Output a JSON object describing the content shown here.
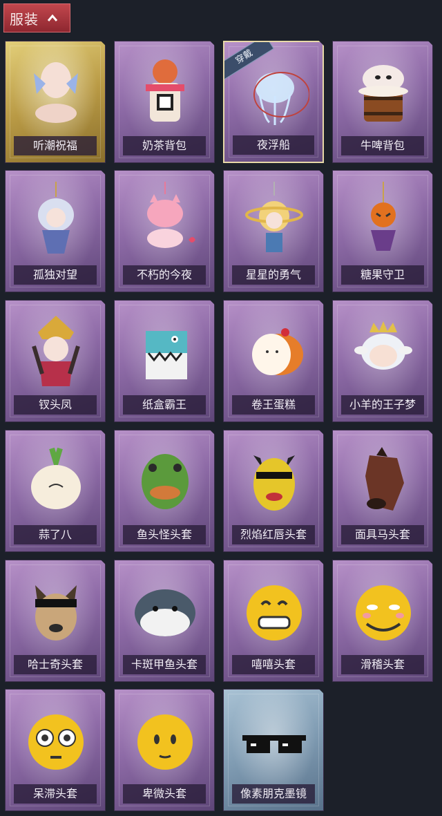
{
  "header": {
    "title": "服装"
  },
  "items": [
    {
      "label": "听潮祝福",
      "theme": "gold",
      "icon": "ghost-doll-icon"
    },
    {
      "label": "奶茶背包",
      "theme": "purple",
      "icon": "milk-tea-fox-icon"
    },
    {
      "label": "夜浮船",
      "theme": "purple",
      "icon": "jellyfish-icon",
      "badge": "穿戴",
      "selected": true
    },
    {
      "label": "牛啤背包",
      "theme": "purple",
      "icon": "cow-beer-barrel-icon"
    },
    {
      "label": "孤独对望",
      "theme": "purple",
      "icon": "doll-charm-icon"
    },
    {
      "label": "不朽的今夜",
      "theme": "purple",
      "icon": "pink-fox-charm-icon"
    },
    {
      "label": "星星的勇气",
      "theme": "purple",
      "icon": "prince-charm-icon"
    },
    {
      "label": "糖果守卫",
      "theme": "purple",
      "icon": "pumpkin-charm-icon"
    },
    {
      "label": "钗头凤",
      "theme": "purple",
      "icon": "phoenix-crown-doll-icon"
    },
    {
      "label": "纸盒霸王",
      "theme": "purple",
      "icon": "box-dinosaur-icon"
    },
    {
      "label": "卷王蛋糕",
      "theme": "purple",
      "icon": "roll-cake-icon"
    },
    {
      "label": "小羊的王子梦",
      "theme": "purple",
      "icon": "crowned-sheep-icon"
    },
    {
      "label": "蒜了八",
      "theme": "purple",
      "icon": "garlic-icon"
    },
    {
      "label": "鱼头怪头套",
      "theme": "purple",
      "icon": "fish-head-mask-icon"
    },
    {
      "label": "烈焰红唇头套",
      "theme": "purple",
      "icon": "pikachu-mask-icon"
    },
    {
      "label": "面具马头套",
      "theme": "purple",
      "icon": "horse-mask-icon"
    },
    {
      "label": "哈士奇头套",
      "theme": "purple",
      "icon": "husky-mask-icon"
    },
    {
      "label": "卡斑甲鱼头套",
      "theme": "purple",
      "icon": "fish-mask-icon"
    },
    {
      "label": "嘻嘻头套",
      "theme": "purple",
      "icon": "grin-emoji-icon"
    },
    {
      "label": "滑稽头套",
      "theme": "purple",
      "icon": "smirk-emoji-icon"
    },
    {
      "label": "呆滞头套",
      "theme": "purple",
      "icon": "dazed-emoji-icon"
    },
    {
      "label": "卑微头套",
      "theme": "purple",
      "icon": "humble-emoji-icon"
    },
    {
      "label": "像素朋克墨镜",
      "theme": "blue",
      "icon": "pixel-sunglasses-icon"
    }
  ],
  "colors": {
    "background": "#1c2029",
    "header": "#b23a42",
    "card_purple": "#8d6aa6",
    "card_gold": "#c8ae55",
    "card_blue": "#7f9bb2"
  }
}
